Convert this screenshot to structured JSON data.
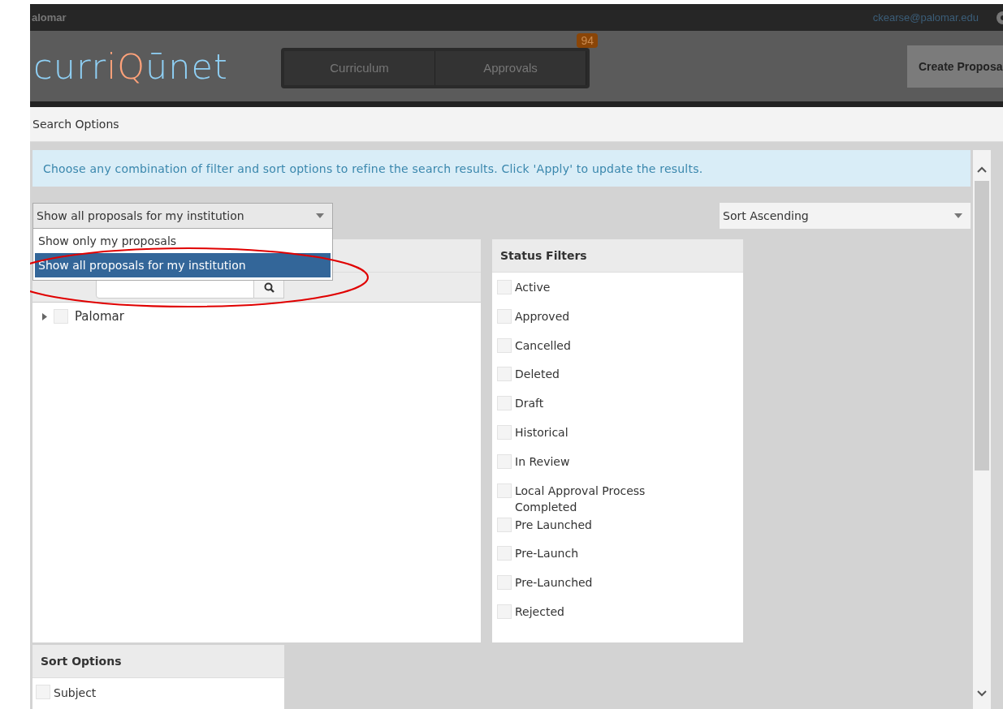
{
  "top_bar": {
    "site": "alomar",
    "user_email": "ckearse@palomar.edu"
  },
  "logo": [
    {
      "text": "curr",
      "color": "#8fd0f5"
    },
    {
      "text": "iQ",
      "color": "#ffa27a"
    },
    {
      "text": "ūnet",
      "color": "#8fd0f5"
    }
  ],
  "nav_tabs": [
    {
      "label": "Curriculum"
    },
    {
      "label": "Approvals",
      "badge": "94"
    }
  ],
  "create_button": "Create Proposa",
  "section_title": "Search Options",
  "info": "Choose any combination of filter and sort options to refine the search results. Click 'Apply' to update the results.",
  "scope_select": {
    "value": "Show all proposals for my institution",
    "options": [
      {
        "label": "Show only my proposals",
        "selected": false
      },
      {
        "label": "Show all proposals for my institution",
        "selected": true
      }
    ]
  },
  "sort_select": {
    "value": "Sort Ascending"
  },
  "tree": {
    "items": [
      {
        "label": "Palomar",
        "checked": false,
        "expanded": false
      }
    ]
  },
  "status_filters": {
    "title": "Status Filters",
    "items": [
      {
        "label": "Active",
        "checked": false
      },
      {
        "label": "Approved",
        "checked": false
      },
      {
        "label": "Cancelled",
        "checked": false
      },
      {
        "label": "Deleted",
        "checked": false
      },
      {
        "label": "Draft",
        "checked": false
      },
      {
        "label": "Historical",
        "checked": false
      },
      {
        "label": "In Review",
        "checked": false
      },
      {
        "label": "Local Approval Process Completed",
        "checked": false
      },
      {
        "label": "Pre Launched",
        "checked": false
      },
      {
        "label": "Pre-Launch",
        "checked": false
      },
      {
        "label": "Pre-Launched",
        "checked": false
      },
      {
        "label": "Rejected",
        "checked": false
      }
    ]
  },
  "sort_options": {
    "title": "Sort Options",
    "items": [
      {
        "label": "Subject",
        "checked": false
      }
    ]
  }
}
